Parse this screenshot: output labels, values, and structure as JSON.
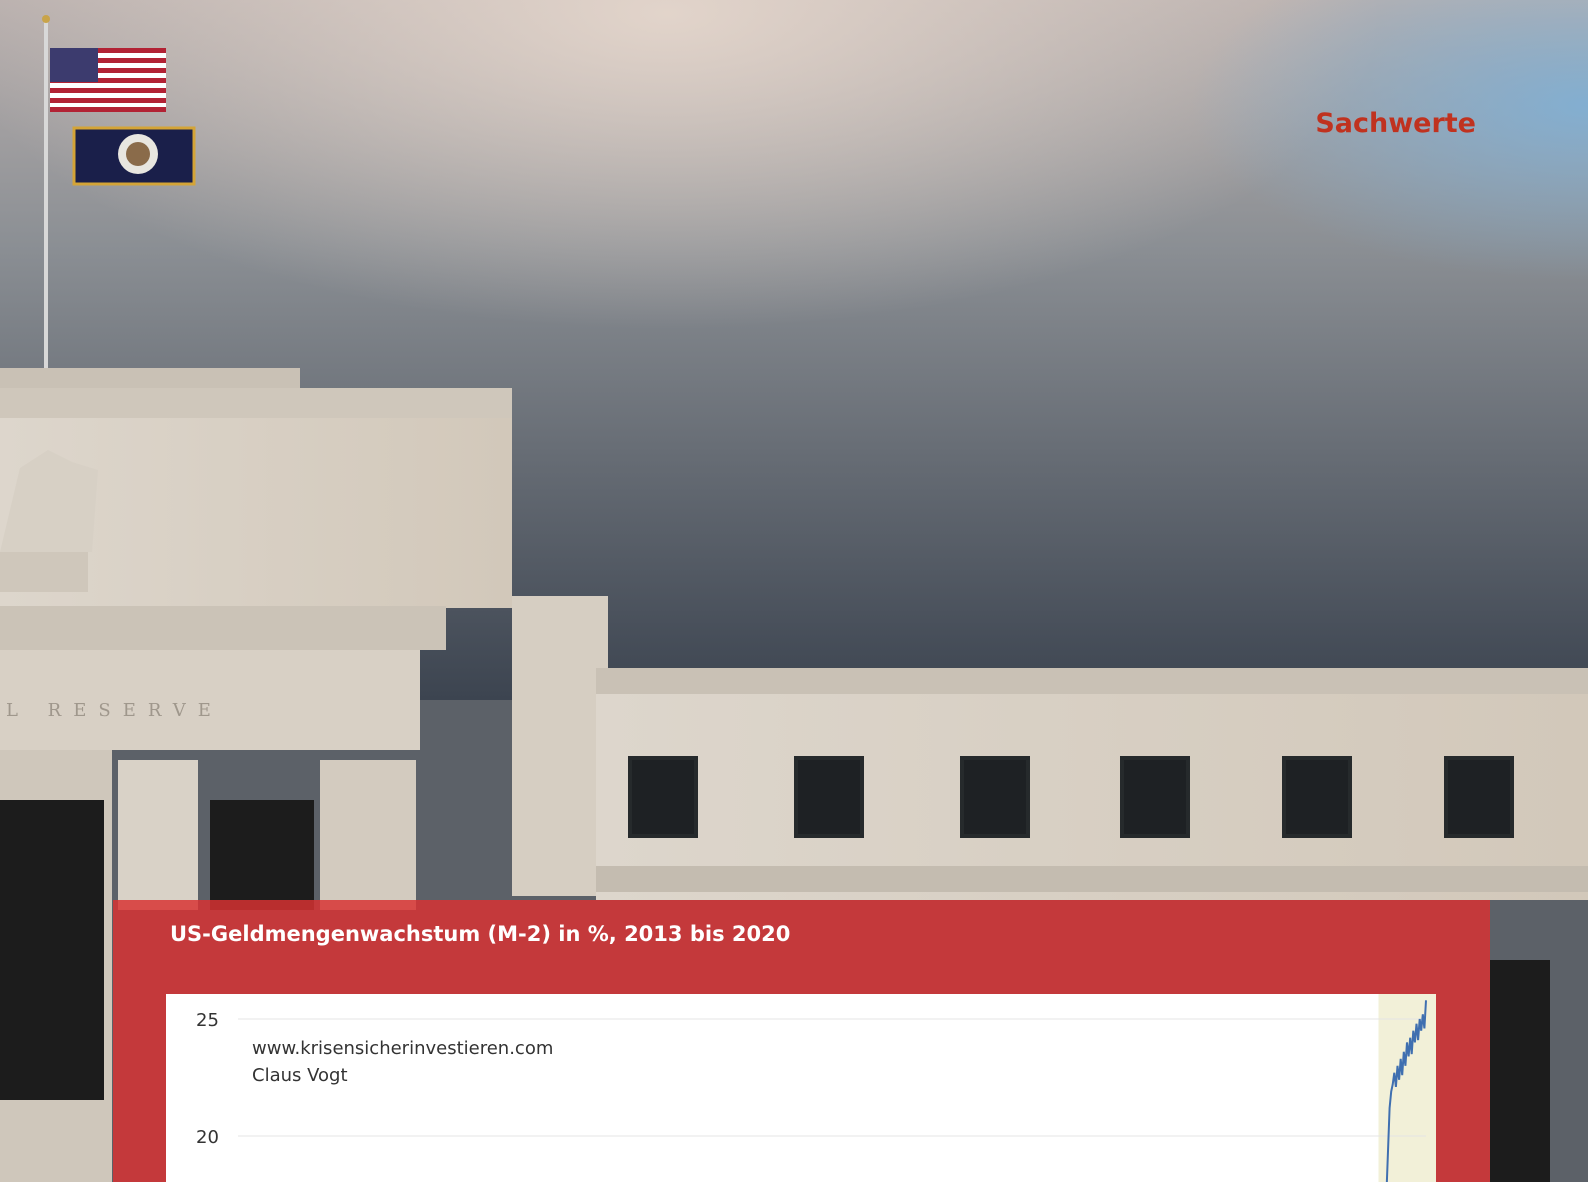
{
  "page": {
    "section_label": "Sachwerte",
    "engraving": "L RESERVE",
    "colors": {
      "accent": "#c0321f",
      "overlay": "#d83232",
      "line": "#3f6fb0",
      "highlight": "#f2f0d8"
    }
  },
  "chart_data": {
    "type": "line",
    "title": "US-Geldmengenwachstum (M-2) in %, 2013 bis 2020",
    "xlabel": "",
    "ylabel": "",
    "x_range": [
      2013,
      2020.5
    ],
    "ylim": [
      17.5,
      26
    ],
    "yticks": [
      20,
      25
    ],
    "annotations": [
      "www.krisensicherinvestieren.com",
      "Claus Vogt"
    ],
    "highlight_range": [
      2020.2,
      2020.5
    ],
    "series": [
      {
        "x": [
          2020.25,
          2020.27,
          2020.28,
          2020.29,
          2020.3,
          2020.31,
          2020.32,
          2020.33,
          2020.34,
          2020.35,
          2020.36,
          2020.37,
          2020.38,
          2020.39,
          2020.4,
          2020.41,
          2020.42,
          2020.43,
          2020.44,
          2020.45,
          2020.46,
          2020.47,
          2020.48,
          2020.49,
          2020.5
        ],
        "values": [
          17.5,
          21.2,
          21.9,
          22.2,
          22.7,
          22.1,
          23.0,
          22.4,
          23.3,
          22.6,
          23.6,
          23.0,
          24.0,
          23.4,
          24.2,
          23.5,
          24.5,
          24.0,
          24.8,
          24.1,
          25.0,
          24.5,
          25.2,
          24.6,
          25.8
        ]
      }
    ]
  }
}
